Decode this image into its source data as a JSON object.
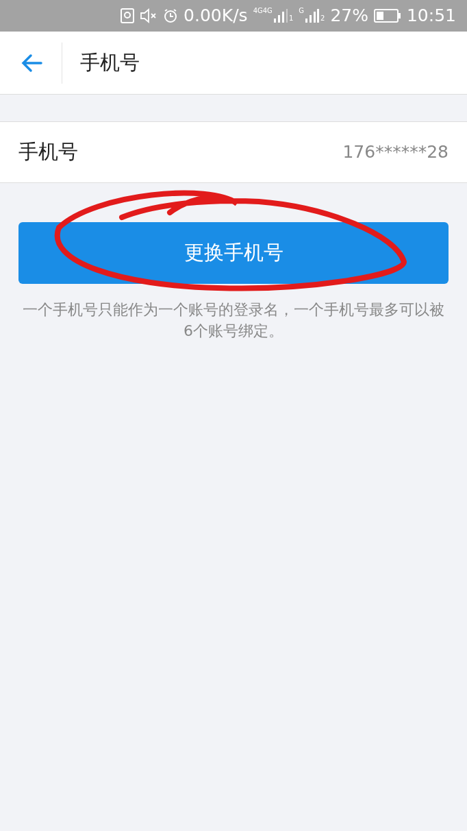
{
  "status_bar": {
    "speed": "0.00K/s",
    "sim1_network": "4G",
    "sim1_network_2": "4G",
    "sim1_index": "1",
    "sim2_network": "G",
    "sim2_index": "2",
    "battery": "27%",
    "time": "10:51"
  },
  "header": {
    "title": "手机号"
  },
  "phone_row": {
    "label": "手机号",
    "value": "176******28"
  },
  "change_button": {
    "label": "更换手机号"
  },
  "hint": "一个手机号只能作为一个账号的登录名，一个手机号最多可以被6个账号绑定。"
}
